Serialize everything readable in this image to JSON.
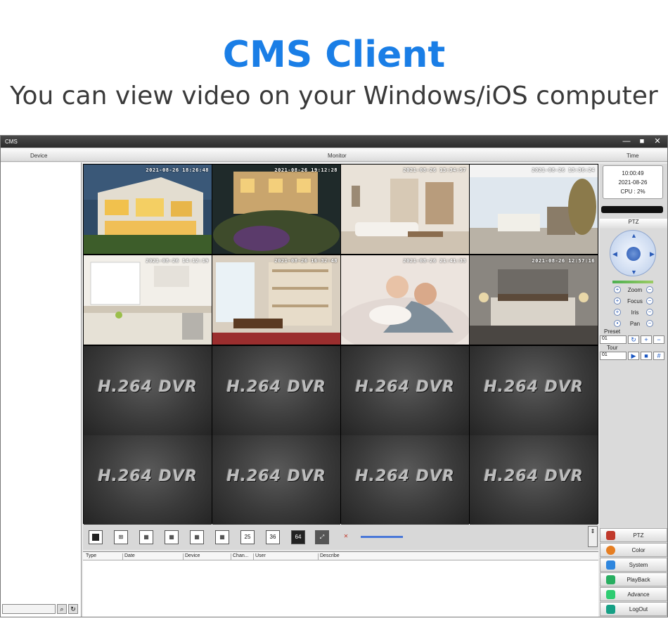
{
  "hero": {
    "title": "CMS Client",
    "subtitle": "You can view video on your Windows/iOS computer"
  },
  "window": {
    "title": "CMS",
    "controls": [
      "—",
      "■",
      "✕"
    ]
  },
  "header": {
    "device": "Device",
    "monitor": "Monitor",
    "time": "Time"
  },
  "clock": {
    "time": "10:00:49",
    "date": "2021-08-26",
    "cpu": "CPU : 2%"
  },
  "ptz": {
    "title": "PTZ",
    "zoom": "Zoom",
    "focus": "Focus",
    "iris": "Iris",
    "pan": "Pan",
    "preset_label": "Preset",
    "preset_value": "01",
    "tour_label": "Tour",
    "tour_value": "01"
  },
  "cameras": [
    {
      "ts": "2021-08-26 18:26:48",
      "scene": "villa"
    },
    {
      "ts": "2021-08-26 19:12:28",
      "scene": "garden"
    },
    {
      "ts": "2021-08-26 13:34:57",
      "scene": "living"
    },
    {
      "ts": "2021-08-26 13:36:24",
      "scene": "balcony"
    },
    {
      "ts": "2021-08-26 14:12:19",
      "scene": "kitchen"
    },
    {
      "ts": "2021-08-26 16:32:48",
      "scene": "study"
    },
    {
      "ts": "2021-08-26 21:41:33",
      "scene": "bedroom-baby"
    },
    {
      "ts": "2021-08-26 12:57:16",
      "scene": "bedroom"
    }
  ],
  "dvr_label": "H.264 DVR",
  "toolbar": {
    "split_buttons": [
      "1",
      "4",
      "6",
      "9",
      "8",
      "16",
      "25",
      "36",
      "64"
    ]
  },
  "log": {
    "columns": [
      "Type",
      "Date",
      "Device",
      "Chan...",
      "User",
      "Describe"
    ]
  },
  "menu": [
    {
      "label": "PTZ",
      "color": "#c0392b"
    },
    {
      "label": "Color",
      "color": "#e67e22"
    },
    {
      "label": "System",
      "color": "#2e86de"
    },
    {
      "label": "PlayBack",
      "color": "#27ae60"
    },
    {
      "label": "Advance",
      "color": "#2ecc71"
    },
    {
      "label": "LogOut",
      "color": "#16a085"
    }
  ],
  "colors": {
    "title_blue": "#1a7ee6",
    "monitor_bg": "#000000"
  }
}
